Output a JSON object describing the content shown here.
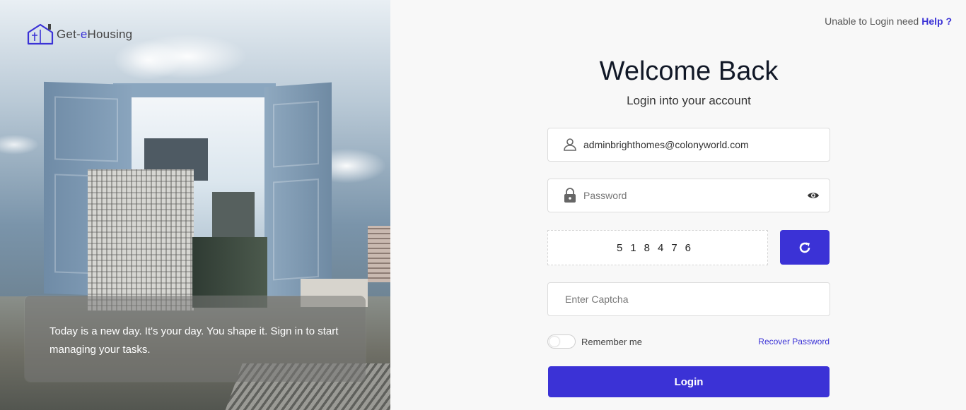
{
  "brand": {
    "name_prefix": "Get-",
    "name_accent": "e",
    "name_suffix": "Housing"
  },
  "hero": {
    "quote": "Today is a new day. It's your day. You shape it. Sign in to start managing your tasks."
  },
  "help": {
    "text": "Unable to Login need",
    "link": "Help ?"
  },
  "form": {
    "title": "Welcome Back",
    "subtitle": "Login into your account",
    "email_value": "adminbrighthomes@colonyworld.com",
    "password_placeholder": "Password",
    "captcha_code": "518476",
    "captcha_placeholder": "Enter Captcha",
    "remember_label": "Remember me",
    "remember_checked": false,
    "recover_link": "Recover Password",
    "login_button": "Login"
  },
  "icons": {
    "user": "user-icon",
    "lock": "lock-icon",
    "eye": "eye-icon",
    "refresh": "refresh-icon",
    "logo": "house-logo-icon"
  },
  "colors": {
    "accent": "#3b32d6",
    "title": "#111827",
    "background": "#f8f8f8"
  }
}
